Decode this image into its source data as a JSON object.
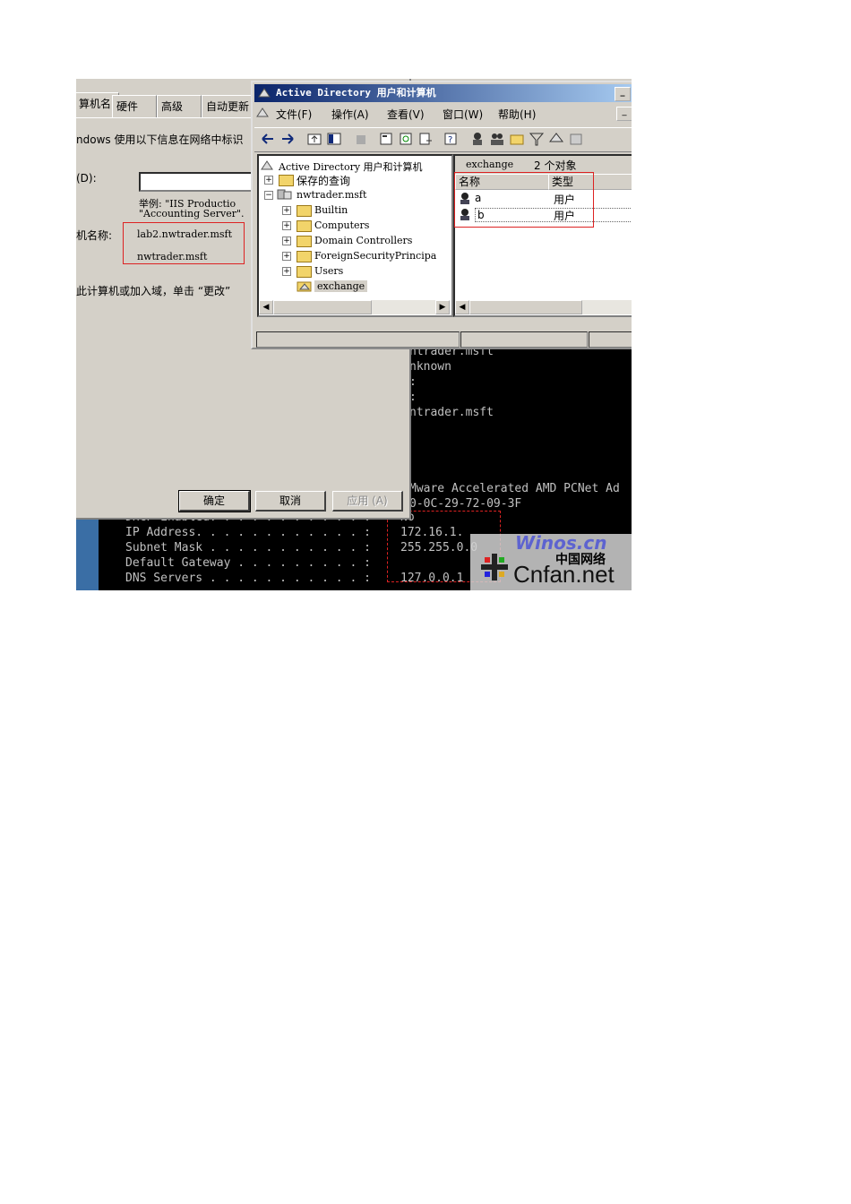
{
  "console": {
    "top_lines": [
      "ntrader.msft",
      "nknown",
      ":",
      ":",
      "ntrader.msft"
    ],
    "adapter_line": "Mware Accelerated AMD PCNet Ad",
    "mac_line": "0-0C-29-72-09-3F",
    "rows": [
      {
        "label": "DHCP Enabled. . . . . . . . . . . :",
        "value": "No"
      },
      {
        "label": "IP Address. . . . . . . . . . . . :",
        "value": "172.16.1."
      },
      {
        "label": "Subnet Mask . . . . . . . . . . . :",
        "value": "255.255.0.0"
      },
      {
        "label": "Default Gateway . . . . . . . . . :",
        "value": ""
      },
      {
        "label": "DNS Servers . . . . . . . . . . . :",
        "value": "127.0.0.1"
      }
    ]
  },
  "system_dialog": {
    "tabs": [
      "算机名",
      "硬件",
      "高级",
      "自动更新"
    ],
    "description": "ndows 使用以下信息在网络中标识",
    "description_label": "(D):",
    "example_line1": "举例: \"IIS Productio",
    "example_line2": "\"Accounting Server\".",
    "fullname_label": "机名称:",
    "fullname_value": "lab2.nwtrader.msft",
    "domain_value": "nwtrader.msft",
    "change_hint": "此计算机或加入域，单击 “更改”",
    "buttons": {
      "ok": "确定",
      "cancel": "取消",
      "apply": "应用 (A)"
    }
  },
  "ad_window": {
    "title": "Active Directory 用户和计算机",
    "menu": [
      "文件(F)",
      "操作(A)",
      "查看(V)",
      "窗口(W)",
      "帮助(H)"
    ],
    "tree": [
      {
        "label": "Active Directory 用户和计算机",
        "level": 0
      },
      {
        "label": "保存的查询",
        "level": 1
      },
      {
        "label": "nwtrader.msft",
        "level": 1
      },
      {
        "label": "Builtin",
        "level": 2
      },
      {
        "label": "Computers",
        "level": 2
      },
      {
        "label": "Domain Controllers",
        "level": 2
      },
      {
        "label": "ForeignSecurityPrincipa",
        "level": 2
      },
      {
        "label": "Users",
        "level": 2
      },
      {
        "label": "exchange",
        "level": 2
      }
    ],
    "list_header_name": "exchange",
    "list_header_count": "2 个对象",
    "columns": [
      "名称",
      "类型"
    ],
    "rows": [
      {
        "name": "a",
        "type": "用户"
      },
      {
        "name": "b",
        "type": "用户"
      }
    ]
  },
  "watermark": {
    "cn": "中国网络",
    "net": "Cnfan.net",
    "overlay": "Winos.cn"
  }
}
